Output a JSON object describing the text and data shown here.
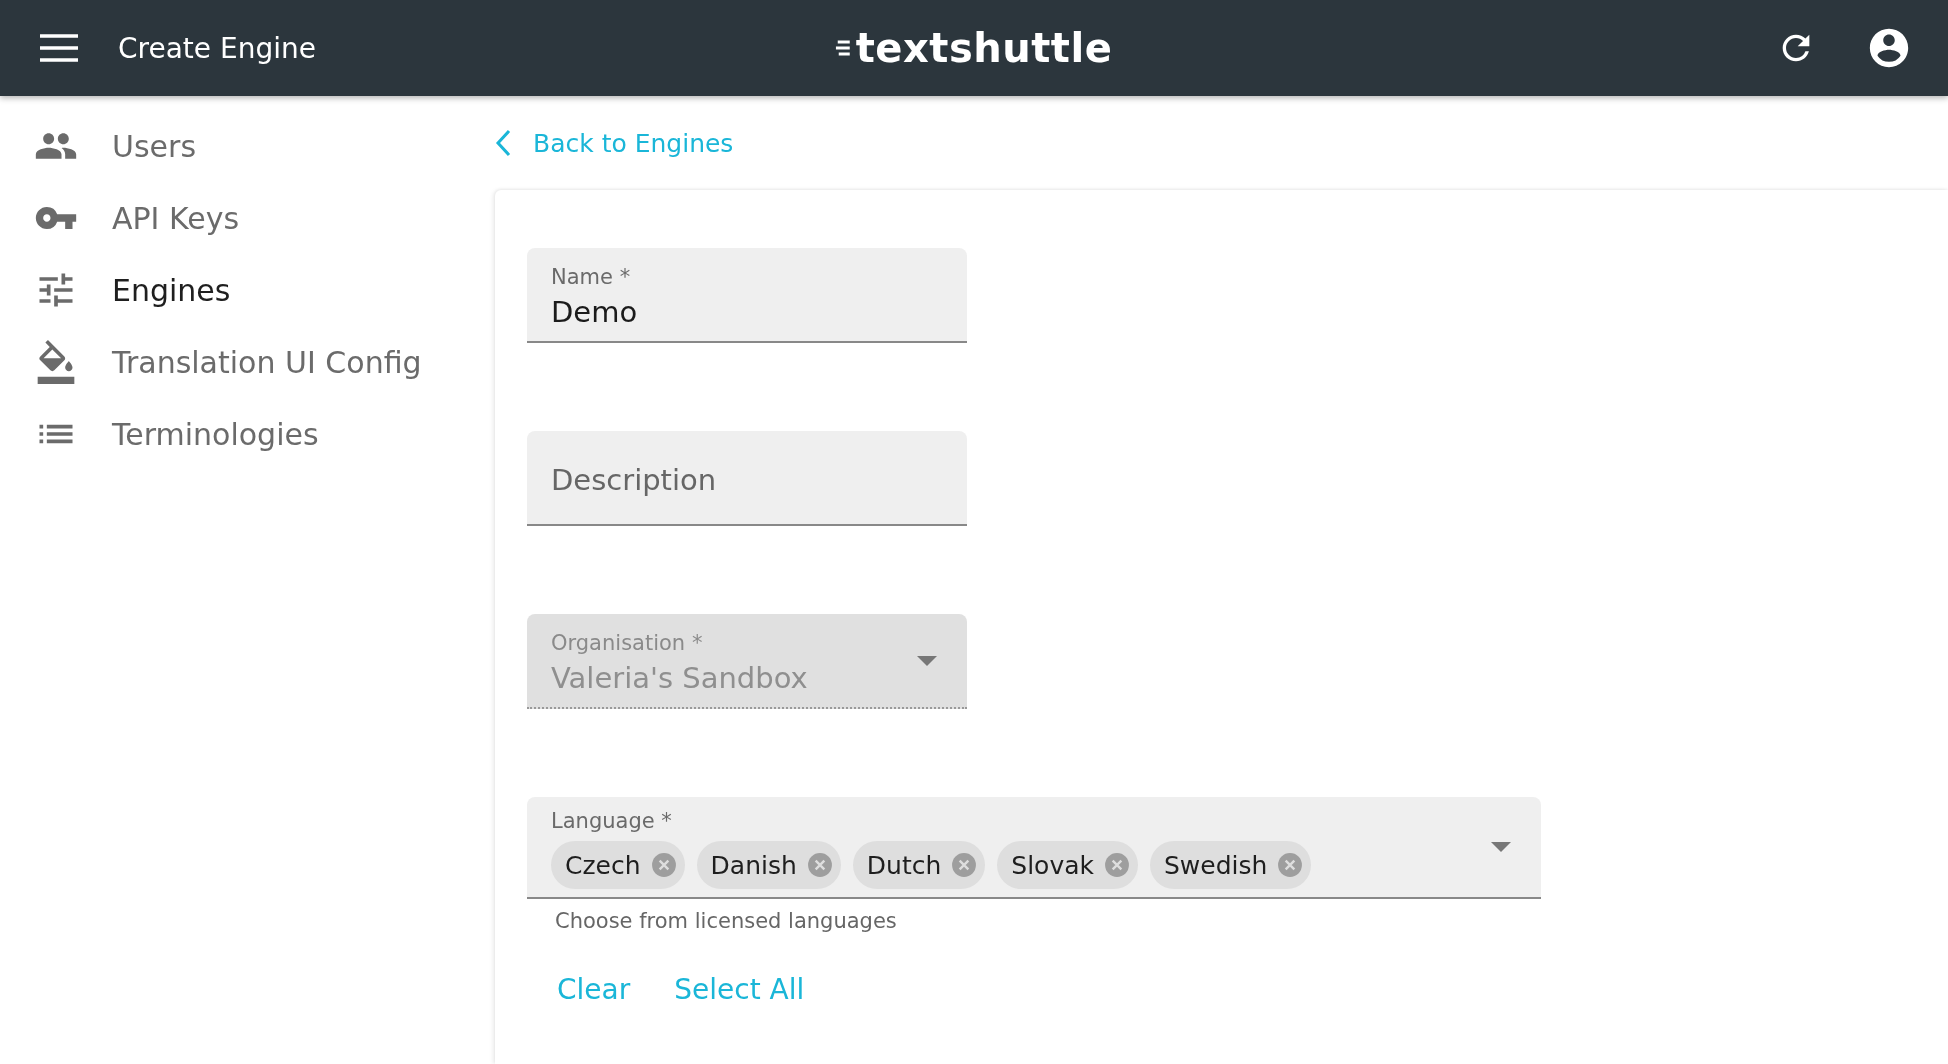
{
  "app_bar": {
    "title": "Create Engine",
    "logo": "textshuttle"
  },
  "sidebar": {
    "items": [
      {
        "label": "Users",
        "selected": false
      },
      {
        "label": "API Keys",
        "selected": false
      },
      {
        "label": "Engines",
        "selected": true
      },
      {
        "label": "Translation UI Config",
        "selected": false
      },
      {
        "label": "Terminologies",
        "selected": false
      }
    ]
  },
  "back_link": "Back to Engines",
  "form": {
    "name": {
      "label": "Name",
      "required": "*",
      "value": "Demo"
    },
    "description": {
      "placeholder": "Description"
    },
    "organisation": {
      "label": "Organisation",
      "required": "*",
      "value": "Valeria's Sandbox",
      "disabled": true
    },
    "language": {
      "label": "Language",
      "required": "*",
      "chips": [
        "Czech",
        "Danish",
        "Dutch",
        "Slovak",
        "Swedish"
      ],
      "helper": "Choose from licensed languages"
    },
    "actions": [
      "Clear",
      "Select All"
    ]
  }
}
